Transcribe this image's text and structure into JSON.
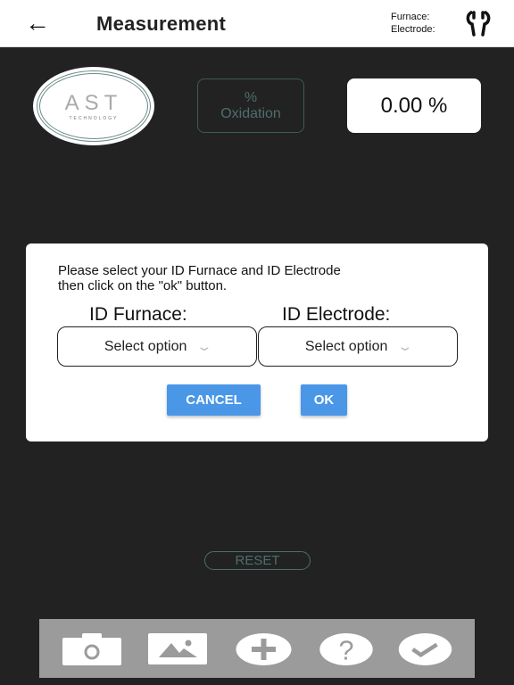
{
  "header": {
    "title": "Measurement",
    "furnace_label": "Furnace:",
    "electrode_label": "Electrode:",
    "back_icon": "arrow-left-icon",
    "settings_icon": "wrench-icon"
  },
  "logo": {
    "text": "AST",
    "subtext": "TECHNOLOGY"
  },
  "oxidation": {
    "symbol": "%",
    "label": "Oxidation",
    "value": "0.00 %"
  },
  "dialog": {
    "message_line1": "Please select your ID Furnace and ID Electrode",
    "message_line2": "then click on the \"ok\" button.",
    "furnace_label": "ID Furnace:",
    "electrode_label": "ID Electrode:",
    "furnace_select": "Select option",
    "electrode_select": "Select option",
    "cancel": "CANCEL",
    "ok": "OK",
    "accent": "#4a97e8"
  },
  "reset": "RESET",
  "toolbar": {
    "icons": [
      "camera-icon",
      "image-icon",
      "plus-icon",
      "help-icon",
      "check-icon"
    ]
  }
}
